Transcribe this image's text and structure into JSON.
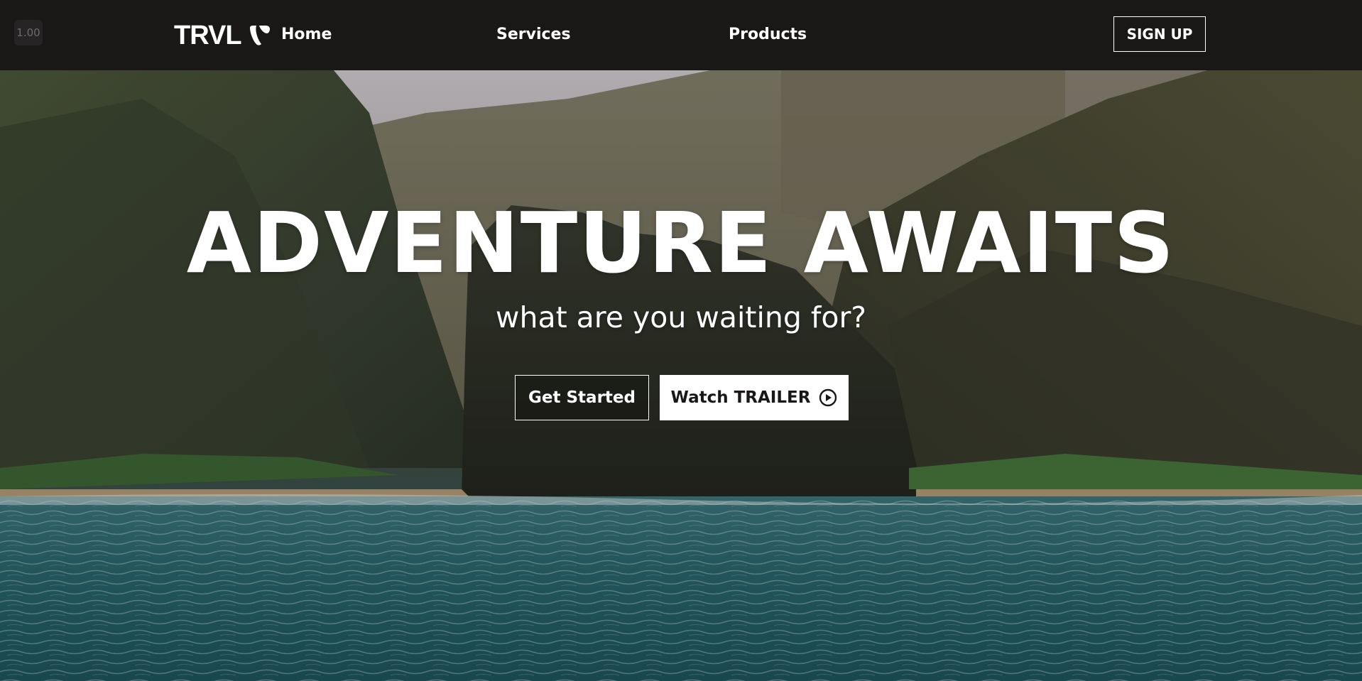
{
  "zoom": "1.00",
  "navbar": {
    "logo_text": "TRVL",
    "logo_icon": "typo3-icon",
    "links": [
      "Home",
      "Services",
      "Products"
    ],
    "signup_label": "SIGN UP"
  },
  "hero": {
    "title": "ADVENTURE AWAITS",
    "subtitle": "what are you waiting for?",
    "primary_button": "Get Started",
    "secondary_button": "Watch TRAILER",
    "secondary_button_icon": "play-circle-icon",
    "background": "sea-cliffs-photo"
  },
  "colors": {
    "navbar_bg": "#1a1717",
    "text": "#ffffff",
    "button_light_bg": "#ffffff"
  }
}
